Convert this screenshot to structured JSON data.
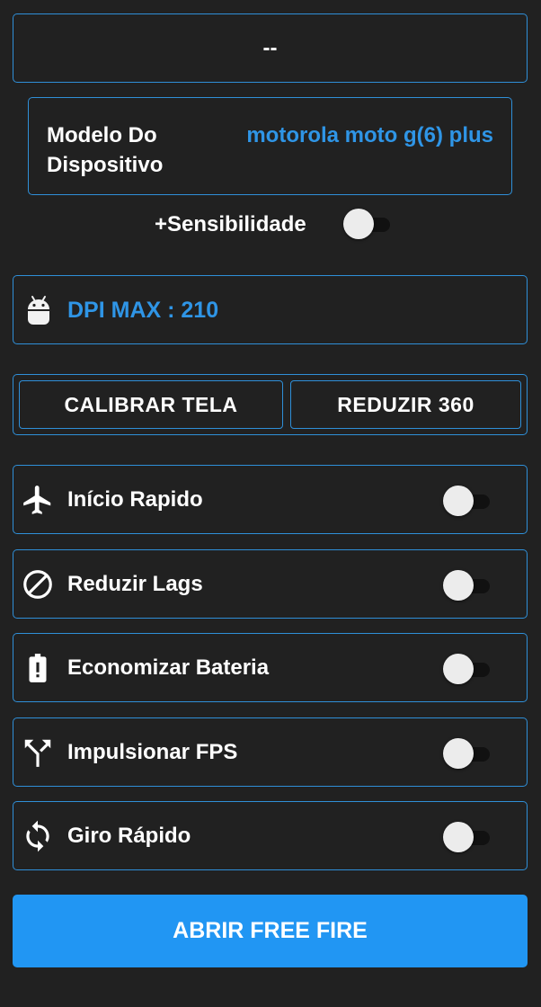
{
  "header": {
    "text": "--"
  },
  "device": {
    "label": "Modelo Do Dispositivo",
    "value": "motorola moto g(6) plus"
  },
  "sensitivity": {
    "label": "+Sensibilidade",
    "enabled": false
  },
  "dpi": {
    "icon": "android-icon",
    "text": "DPI MAX : 210"
  },
  "actions": {
    "calibrate_label": "CALIBRAR TELA",
    "reduce_label": "REDUZIR 360"
  },
  "options": [
    {
      "icon": "airplane-icon",
      "label": "Início Rapido",
      "enabled": false
    },
    {
      "icon": "block-icon",
      "label": "Reduzir Lags",
      "enabled": false
    },
    {
      "icon": "battery-alert-icon",
      "label": "Economizar Bateria",
      "enabled": false
    },
    {
      "icon": "call-merge-icon",
      "label": "Impulsionar FPS",
      "enabled": false
    },
    {
      "icon": "sync-icon",
      "label": "Giro Rápido",
      "enabled": false
    }
  ],
  "open_button": {
    "label": "ABRIR FREE FIRE"
  },
  "colors": {
    "background": "#212121",
    "accent": "#2f8fd8",
    "accent_text": "#2f95e6",
    "button": "#2196f3"
  }
}
